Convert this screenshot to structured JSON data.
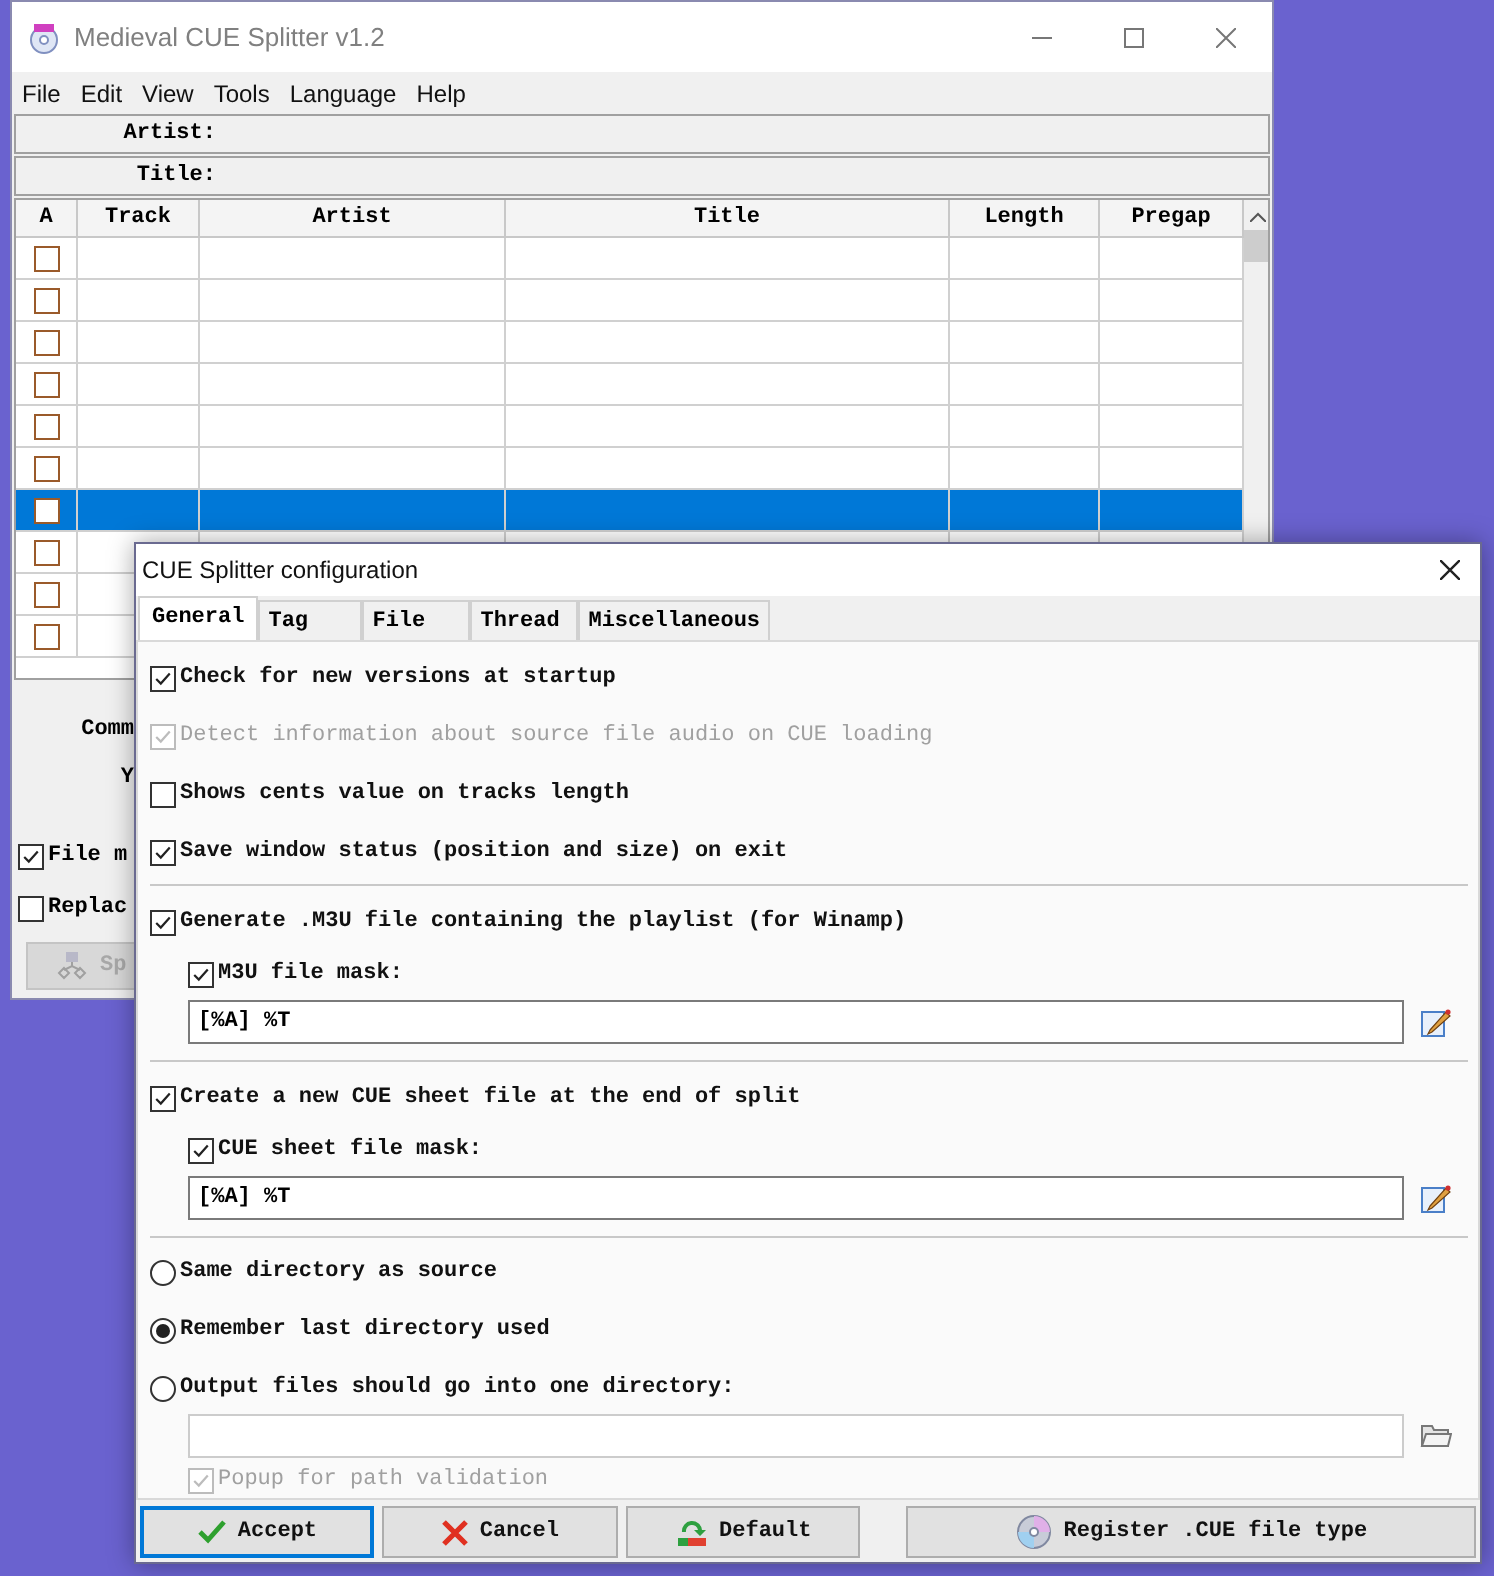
{
  "main_window": {
    "title": "Medieval CUE Splitter v1.2",
    "menu": [
      "File",
      "Edit",
      "View",
      "Tools",
      "Language",
      "Help"
    ],
    "artist_label": "Artist:",
    "title_label": "Title:",
    "table": {
      "columns": [
        "A",
        "Track",
        "Artist",
        "Title",
        "Length",
        "Pregap"
      ],
      "rows": [
        {
          "checked": false,
          "selected": false
        },
        {
          "checked": false,
          "selected": false
        },
        {
          "checked": false,
          "selected": false
        },
        {
          "checked": false,
          "selected": false
        },
        {
          "checked": false,
          "selected": false
        },
        {
          "checked": false,
          "selected": false
        },
        {
          "checked": false,
          "selected": true
        },
        {
          "checked": false,
          "selected": false
        },
        {
          "checked": false,
          "selected": false
        },
        {
          "checked": false,
          "selected": false
        }
      ]
    },
    "labels": [
      "Comm",
      "Y"
    ],
    "options": [
      {
        "label": "File m",
        "checked": true
      },
      {
        "label": "Replac",
        "checked": false
      }
    ],
    "split_button": {
      "label": "Sp",
      "disabled": true
    }
  },
  "dialog": {
    "title": "CUE Splitter configuration",
    "tabs": [
      {
        "label": "General",
        "selected": true
      },
      {
        "label": "Tag",
        "selected": false
      },
      {
        "label": "File",
        "selected": false
      },
      {
        "label": "Thread",
        "selected": false
      },
      {
        "label": "Miscellaneous",
        "selected": false
      }
    ],
    "sections": [
      [
        {
          "kind": "checkbox",
          "label": "Check for new versions at startup",
          "checked": true,
          "disabled": false
        },
        {
          "kind": "checkbox",
          "label": "Detect information about source file audio on CUE loading",
          "checked": true,
          "disabled": true
        },
        {
          "kind": "checkbox",
          "label": "Shows cents value on tracks length",
          "checked": false,
          "disabled": false
        },
        {
          "kind": "checkbox",
          "label": "Save window status (position and size) on exit",
          "checked": true,
          "disabled": false
        }
      ],
      [
        {
          "kind": "checkbox",
          "label": "Generate .M3U file containing the playlist (for Winamp)",
          "checked": true,
          "disabled": false,
          "children": [
            {
              "kind": "checkbox",
              "label": "M3U file mask:",
              "checked": true,
              "disabled": false
            },
            {
              "kind": "mask_field",
              "value": "[%A] %T"
            }
          ]
        }
      ],
      [
        {
          "kind": "checkbox",
          "label": "Create a new CUE sheet file at the end of split",
          "checked": true,
          "disabled": false,
          "children": [
            {
              "kind": "checkbox",
              "label": "CUE sheet file mask:",
              "checked": true,
              "disabled": false
            },
            {
              "kind": "mask_field",
              "value": "[%A] %T"
            }
          ]
        }
      ],
      [
        {
          "kind": "radio",
          "label": "Same directory as source",
          "selected": false
        },
        {
          "kind": "radio",
          "label": "Remember last directory used",
          "selected": true
        },
        {
          "kind": "radio",
          "label": "Output files should go into one directory:",
          "selected": false,
          "children": [
            {
              "kind": "folder_field"
            },
            {
              "kind": "checkbox",
              "label": "Popup for path validation",
              "checked": true,
              "disabled": true
            }
          ]
        }
      ]
    ],
    "buttons": [
      {
        "kind": "accept",
        "label": "Accept",
        "focused": true
      },
      {
        "kind": "cancel",
        "label": "Cancel",
        "focused": false
      },
      {
        "kind": "default",
        "label": "Default",
        "focused": false
      },
      {
        "kind": "register",
        "label": "Register .CUE file type",
        "focused": false
      }
    ]
  }
}
